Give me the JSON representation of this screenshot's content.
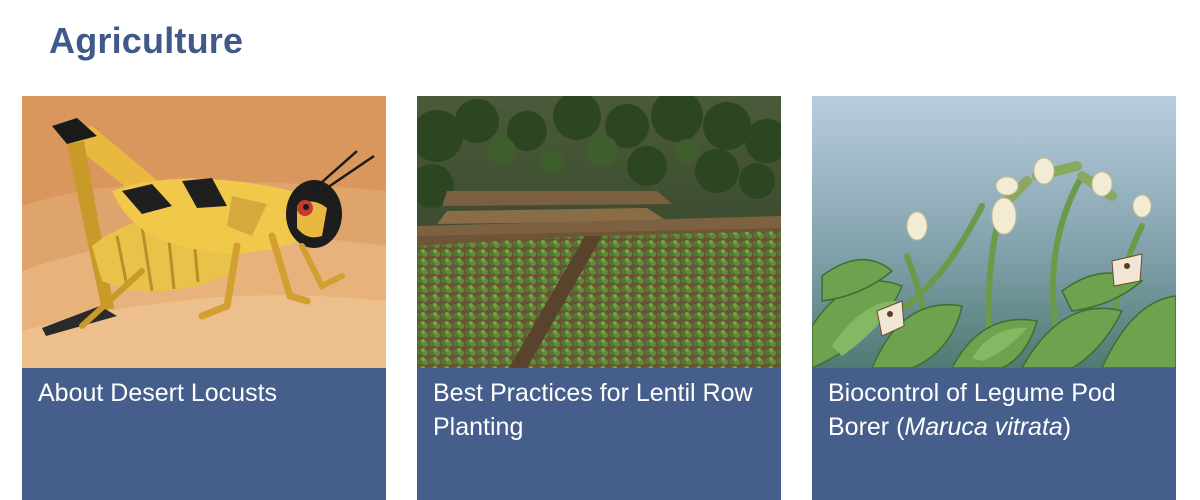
{
  "section": {
    "title": "Agriculture"
  },
  "cards": [
    {
      "title": "About Desert Locusts",
      "image_subject": "desert locust illustration"
    },
    {
      "title": "Best Practices for Lentil Row Planting",
      "image_subject": "lentil field photo"
    },
    {
      "title_before": "Biocontrol of Legume Pod Borer (",
      "title_italic": "Maruca vitrata",
      "title_after": ")",
      "image_subject": "legume pod borer moth illustration"
    }
  ],
  "colors": {
    "heading": "#3f5a8a",
    "caption_background": "#465e8c",
    "caption_text": "#ffffff"
  }
}
